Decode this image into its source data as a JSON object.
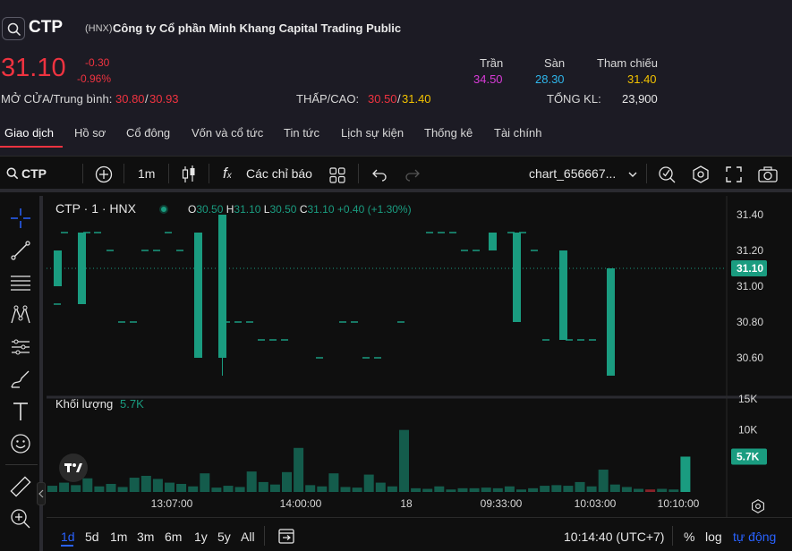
{
  "header": {
    "ticker": "CTP",
    "exchange": "(HNX)",
    "company": "Công ty Cổ phần Minh Khang Capital Trading Public",
    "price": "31.10",
    "change": "-0.30",
    "change_pct": "-0.96%",
    "open_avg_label": "MỞ CỬA/Trung bình:",
    "open": "30.80",
    "sep": "/",
    "avg": "30.93",
    "lowhigh_label": "THẤP/CAO:",
    "low": "30.50",
    "high": "31.40",
    "ceiling_label": "Trần",
    "ceiling": "34.50",
    "floor_label": "Sàn",
    "floor": "28.30",
    "ref_label": "Tham chiếu",
    "ref": "31.40",
    "volume_label": "TỔNG KL:",
    "volume": "23,900"
  },
  "tabs": [
    "Giao dịch",
    "Hồ sơ",
    "Cổ đông",
    "Vốn và cổ tức",
    "Tin tức",
    "Lịch sự kiện",
    "Thống kê",
    "Tài chính"
  ],
  "toolbar": {
    "symbol": "CTP",
    "interval": "1m",
    "indicators": "Các chỉ báo",
    "layout_name": "chart_656667..."
  },
  "legend": {
    "title": "CTP · 1 · HNX",
    "o_label": "O",
    "o": "30.50",
    "h_label": "H",
    "h": "31.10",
    "l_label": "L",
    "l": "30.50",
    "c_label": "C",
    "c": "31.10",
    "chg": "+0.40 (+1.30%)"
  },
  "volume_legend": {
    "label": "Khối lượng",
    "value": "5.7K"
  },
  "bottom": {
    "ranges": [
      "1d",
      "5d",
      "1m",
      "3m",
      "6m",
      "1y",
      "5y",
      "All"
    ],
    "time": "10:14:40 (UTC+7)",
    "pct": "%",
    "log": "log",
    "auto": "tự động"
  },
  "colors": {
    "up": "#1a9c80",
    "down": "#ef3340",
    "accent": "#2962ff",
    "bg": "#0f0f0f"
  },
  "chart_data": {
    "type": "candlestick",
    "y_ticks": [
      "31.40",
      "31.20",
      "31.00",
      "30.80",
      "30.60"
    ],
    "last_price_label": "31.10",
    "volume_ticks": [
      "15K",
      "10K"
    ],
    "volume_last_label": "5.7K",
    "x_ticks": [
      "13:07:00",
      "14:00:00",
      "18",
      "09:33:00",
      "10:03:00",
      "10:10:00"
    ],
    "candles": [
      {
        "o": 31.0,
        "c": 31.2,
        "h": 31.2,
        "l": 31.0
      },
      {
        "o": 30.9,
        "c": 31.3,
        "h": 31.3,
        "l": 30.9
      },
      {
        "o": 30.6,
        "c": 31.3,
        "h": 31.3,
        "l": 30.6
      },
      {
        "o": 30.6,
        "c": 31.4,
        "h": 31.4,
        "l": 30.5
      },
      {
        "o": 31.2,
        "c": 31.3,
        "h": 31.3,
        "l": 31.2
      },
      {
        "o": 30.8,
        "c": 31.3,
        "h": 31.3,
        "l": 30.8
      },
      {
        "o": 30.7,
        "c": 31.2,
        "h": 31.2,
        "l": 30.7
      },
      {
        "o": 30.5,
        "c": 31.1,
        "h": 31.1,
        "l": 30.5
      }
    ],
    "volume_bars_k": [
      1.0,
      1.5,
      1.1,
      2.2,
      0.9,
      1.3,
      0.8,
      2.3,
      2.6,
      2.1,
      1.5,
      1.3,
      0.9,
      3.0,
      0.7,
      1.0,
      0.8,
      3.3,
      1.6,
      1.2,
      3.2,
      7.1,
      1.1,
      0.9,
      3.0,
      0.8,
      0.7,
      2.8,
      1.5,
      0.9,
      10.0,
      0.6,
      0.5,
      0.9,
      0.4,
      0.6,
      0.6,
      0.7,
      0.6,
      0.9,
      0.4,
      0.6,
      1.0,
      1.1,
      1.0,
      1.6,
      0.9,
      3.6,
      1.2,
      0.8,
      0.5,
      0.4,
      0.5,
      0.4,
      5.7
    ]
  }
}
